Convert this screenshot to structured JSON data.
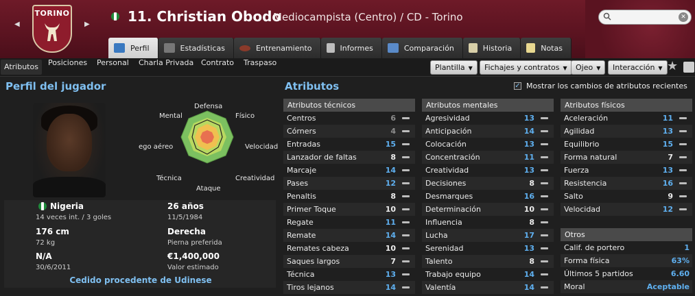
{
  "header": {
    "club_crest_text": "TORINO",
    "player_title": "11. Christian Obodo",
    "player_role": "Mediocampista (Centro) / CD - Torino",
    "search": {
      "placeholder": "",
      "value": ""
    },
    "tabs": [
      {
        "label": "Perfil",
        "icon": "profile-icon",
        "active": true
      },
      {
        "label": "Estadísticas",
        "icon": "stats-icon"
      },
      {
        "label": "Entrenamiento",
        "icon": "training-icon"
      },
      {
        "label": "Informes",
        "icon": "reports-icon"
      },
      {
        "label": "Comparación",
        "icon": "comparison-icon"
      },
      {
        "label": "Historia",
        "icon": "history-icon"
      },
      {
        "label": "Notas",
        "icon": "notes-icon"
      }
    ]
  },
  "subnav": {
    "items": [
      "Atributos",
      "Posiciones",
      "Personal",
      "Charla Privada",
      "Contrato",
      "Traspaso"
    ],
    "dropdowns": [
      "Plantilla",
      "Fichajes y contratos",
      "Ojeo",
      "Interacción"
    ]
  },
  "profile": {
    "title": "Perfil del jugador",
    "radar_labels": {
      "top": "Defensa",
      "top_right": "Físico",
      "right": "Velocidad",
      "bottom_right": "Creatividad",
      "bottom": "Ataque",
      "bottom_left": "Técnica",
      "left": "ego aéreo",
      "top_left": "Mental"
    },
    "nationality": "Nigeria",
    "caps": "14 veces int. / 3 goles",
    "age": "26 años",
    "birth_date": "11/5/1984",
    "height": "176 cm",
    "weight": "72 kg",
    "foot": "Derecha",
    "foot_label": "Pierna preferida",
    "status": "N/A",
    "contract_date": "30/6/2011",
    "value": "€1,400,000",
    "value_label": "Valor estimado",
    "loan_text": "Cedido procedente de Udinese"
  },
  "attributes": {
    "title": "Atributos",
    "show_changes_label": "Mostrar los cambios de atributos recientes",
    "show_changes_checked": true,
    "technical": {
      "header": "Atributos técnicos",
      "rows": [
        {
          "name": "Centros",
          "value": "6",
          "tone": "lo"
        },
        {
          "name": "Córners",
          "value": "4",
          "tone": "lo"
        },
        {
          "name": "Entradas",
          "value": "15",
          "tone": "hi"
        },
        {
          "name": "Lanzador de faltas",
          "value": "8",
          "tone": ""
        },
        {
          "name": "Marcaje",
          "value": "14",
          "tone": "hi"
        },
        {
          "name": "Pases",
          "value": "12",
          "tone": "hi"
        },
        {
          "name": "Penaltis",
          "value": "8",
          "tone": ""
        },
        {
          "name": "Primer Toque",
          "value": "10",
          "tone": ""
        },
        {
          "name": "Regate",
          "value": "11",
          "tone": "hi"
        },
        {
          "name": "Remate",
          "value": "14",
          "tone": "hi"
        },
        {
          "name": "Remates cabeza",
          "value": "10",
          "tone": ""
        },
        {
          "name": "Saques largos",
          "value": "7",
          "tone": ""
        },
        {
          "name": "Técnica",
          "value": "13",
          "tone": "hi"
        },
        {
          "name": "Tiros lejanos",
          "value": "14",
          "tone": "hi"
        }
      ]
    },
    "mental": {
      "header": "Atributos mentales",
      "rows": [
        {
          "name": "Agresividad",
          "value": "13",
          "tone": "hi"
        },
        {
          "name": "Anticipación",
          "value": "14",
          "tone": "hi"
        },
        {
          "name": "Colocación",
          "value": "13",
          "tone": "hi"
        },
        {
          "name": "Concentración",
          "value": "11",
          "tone": "hi"
        },
        {
          "name": "Creatividad",
          "value": "13",
          "tone": "hi"
        },
        {
          "name": "Decisiones",
          "value": "8",
          "tone": ""
        },
        {
          "name": "Desmarques",
          "value": "16",
          "tone": "hi"
        },
        {
          "name": "Determinación",
          "value": "10",
          "tone": ""
        },
        {
          "name": "Influencia",
          "value": "8",
          "tone": ""
        },
        {
          "name": "Lucha",
          "value": "17",
          "tone": "hi"
        },
        {
          "name": "Serenidad",
          "value": "13",
          "tone": "hi"
        },
        {
          "name": "Talento",
          "value": "8",
          "tone": ""
        },
        {
          "name": "Trabajo equipo",
          "value": "14",
          "tone": "hi"
        },
        {
          "name": "Valentía",
          "value": "14",
          "tone": "hi"
        }
      ]
    },
    "physical": {
      "header": "Atributos físicos",
      "rows": [
        {
          "name": "Aceleración",
          "value": "11",
          "tone": "hi"
        },
        {
          "name": "Agilidad",
          "value": "13",
          "tone": "hi"
        },
        {
          "name": "Equilibrio",
          "value": "15",
          "tone": "hi"
        },
        {
          "name": "Forma natural",
          "value": "7",
          "tone": ""
        },
        {
          "name": "Fuerza",
          "value": "13",
          "tone": "hi"
        },
        {
          "name": "Resistencia",
          "value": "16",
          "tone": "hi"
        },
        {
          "name": "Salto",
          "value": "9",
          "tone": ""
        },
        {
          "name": "Velocidad",
          "value": "12",
          "tone": "hi"
        }
      ]
    },
    "other": {
      "header": "Otros",
      "rows": [
        {
          "name": "Calif. de portero",
          "value": "1"
        },
        {
          "name": "Forma física",
          "value": "63%"
        },
        {
          "name": "Últimos 5 partidos",
          "value": "6.60"
        },
        {
          "name": "Moral",
          "value": "Aceptable"
        }
      ]
    }
  },
  "colors": {
    "accent": "#7fbff0",
    "high_value": "#5fb0f0",
    "header_bg": "#5a1320"
  }
}
